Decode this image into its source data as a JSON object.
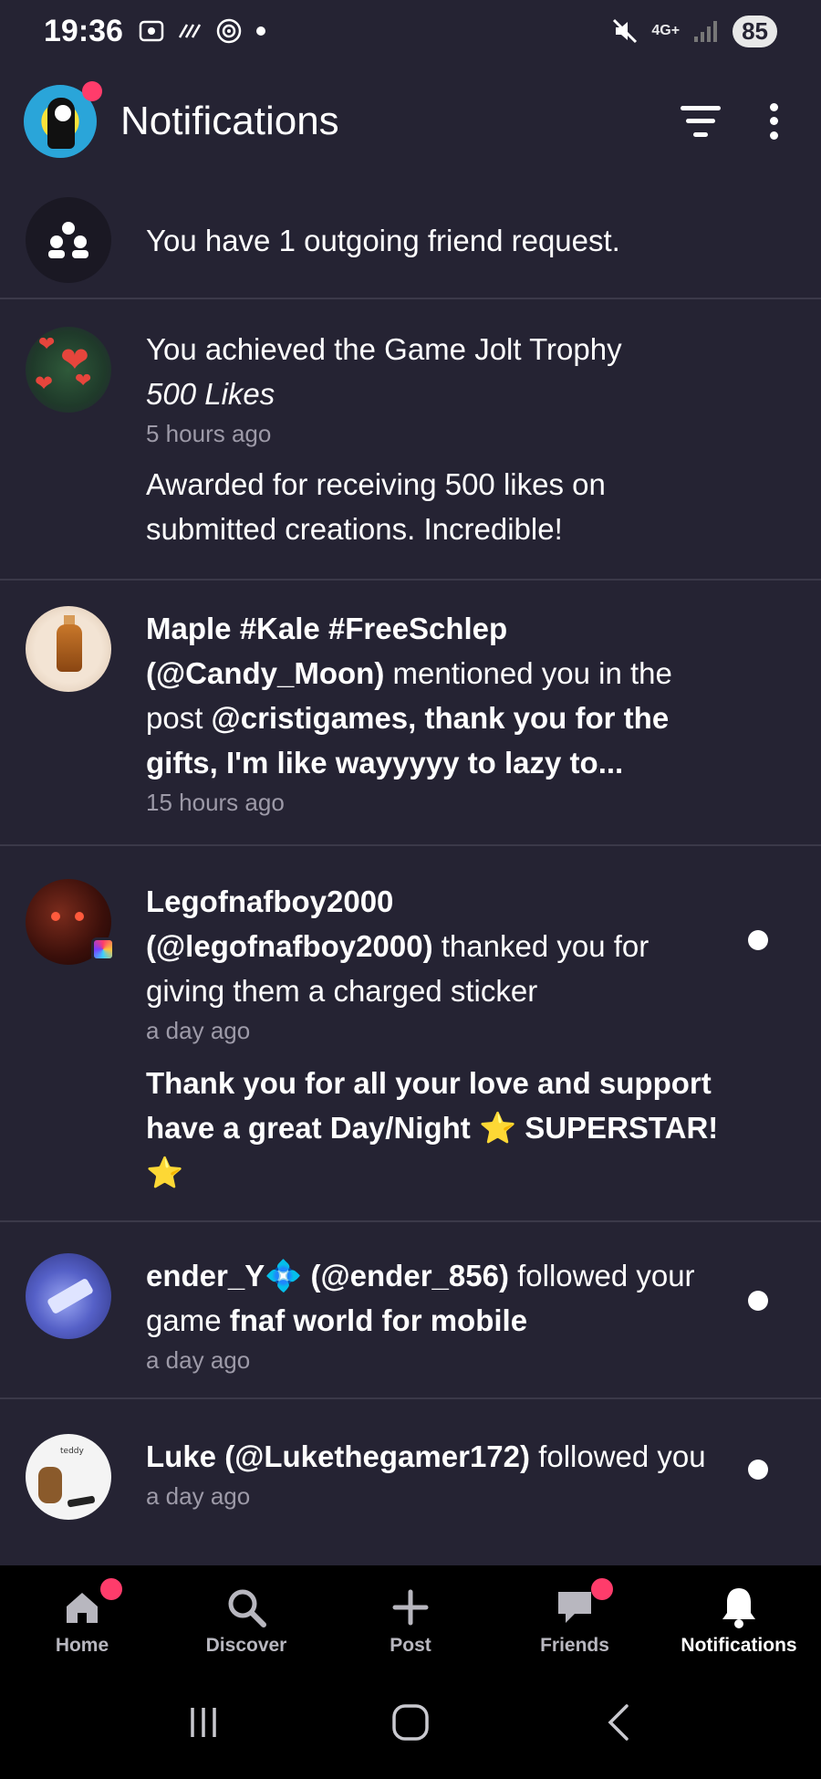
{
  "status_bar": {
    "time": "19:36",
    "network": "4G+",
    "battery": "85"
  },
  "header": {
    "title": "Notifications"
  },
  "notifications": [
    {
      "type": "friend-request",
      "text": "You have 1 outgoing friend request."
    },
    {
      "type": "trophy",
      "text_prefix": "You achieved the Game Jolt Trophy",
      "trophy_name": "500 Likes",
      "time": "5 hours ago",
      "description": "Awarded for receiving 500 likes on submitted creations. Incredible!"
    },
    {
      "type": "mention",
      "user_name": "Maple #Kale #FreeSchlep",
      "user_handle": "(@Candy_Moon)",
      "action": "mentioned you in the post",
      "post_title": "@cristigames, thank you for the gifts, I'm like wayyyyy to lazy to...",
      "time": "15 hours ago"
    },
    {
      "type": "sticker-thanks",
      "user_name": "Legofnafboy2000",
      "user_handle": "(@legofnafboy2000)",
      "action": "thanked you for giving them a charged sticker",
      "time": "a day ago",
      "message": "Thank you for all your love and support have a great Day/Night ⭐ SUPERSTAR! ⭐",
      "unread": true
    },
    {
      "type": "follow-game",
      "user_name": "ender_Y💠",
      "user_handle": "(@ender_856)",
      "action": "followed your game",
      "game_title": "fnaf world for mobile",
      "time": "a day ago",
      "unread": true
    },
    {
      "type": "follow",
      "user_name": "Luke",
      "user_handle": "(@Lukethegamer172)",
      "action": "followed you",
      "time": "a day ago",
      "avatar_caption": "teddy",
      "unread": true
    }
  ],
  "bottom_nav": {
    "items": [
      {
        "label": "Home",
        "icon": "home-icon",
        "badge": true
      },
      {
        "label": "Discover",
        "icon": "search-icon",
        "badge": false
      },
      {
        "label": "Post",
        "icon": "plus-icon",
        "badge": false
      },
      {
        "label": "Friends",
        "icon": "chat-icon",
        "badge": true
      },
      {
        "label": "Notifications",
        "icon": "bell-icon",
        "badge": false,
        "active": true
      }
    ]
  },
  "colors": {
    "background": "#252333",
    "badge": "#ff3c6b",
    "nav_background": "#000000",
    "secondary_text": "#9d9aa8"
  }
}
